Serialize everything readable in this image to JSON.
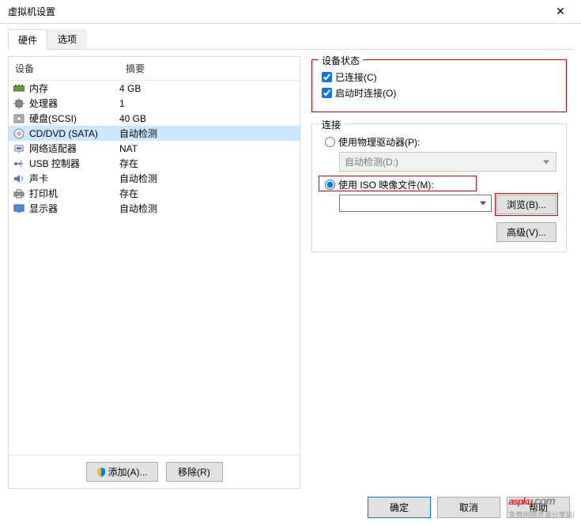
{
  "window": {
    "title": "虚拟机设置",
    "close": "✕"
  },
  "tabs": {
    "hardware": "硬件",
    "options": "选项"
  },
  "list_header": {
    "device": "设备",
    "summary": "摘要"
  },
  "devices": [
    {
      "name": "内存",
      "summary": "4 GB",
      "icon": "memory"
    },
    {
      "name": "处理器",
      "summary": "1",
      "icon": "cpu"
    },
    {
      "name": "硬盘(SCSI)",
      "summary": "40 GB",
      "icon": "disk"
    },
    {
      "name": "CD/DVD (SATA)",
      "summary": "自动检测",
      "icon": "cd",
      "selected": true
    },
    {
      "name": "网络适配器",
      "summary": "NAT",
      "icon": "net"
    },
    {
      "name": "USB 控制器",
      "summary": "存在",
      "icon": "usb"
    },
    {
      "name": "声卡",
      "summary": "自动检测",
      "icon": "sound"
    },
    {
      "name": "打印机",
      "summary": "存在",
      "icon": "printer"
    },
    {
      "name": "显示器",
      "summary": "自动检测",
      "icon": "display"
    }
  ],
  "left_buttons": {
    "add": "添加(A)...",
    "remove": "移除(R)"
  },
  "status_group": {
    "title": "设备状态",
    "connected": "已连接(C)",
    "connect_at_power": "启动时连接(O)"
  },
  "connection_group": {
    "title": "连接",
    "use_physical": "使用物理驱动器(P):",
    "auto_detect": "自动检测(D:)",
    "use_iso": "使用 ISO 映像文件(M):",
    "browse": "浏览(B)...",
    "advanced": "高级(V)..."
  },
  "footer": {
    "ok": "确定",
    "cancel": "取消",
    "help": "帮助"
  },
  "watermark": {
    "brand": "aspku",
    "tld": ".com",
    "sub": "免费网络资源分享站!"
  }
}
